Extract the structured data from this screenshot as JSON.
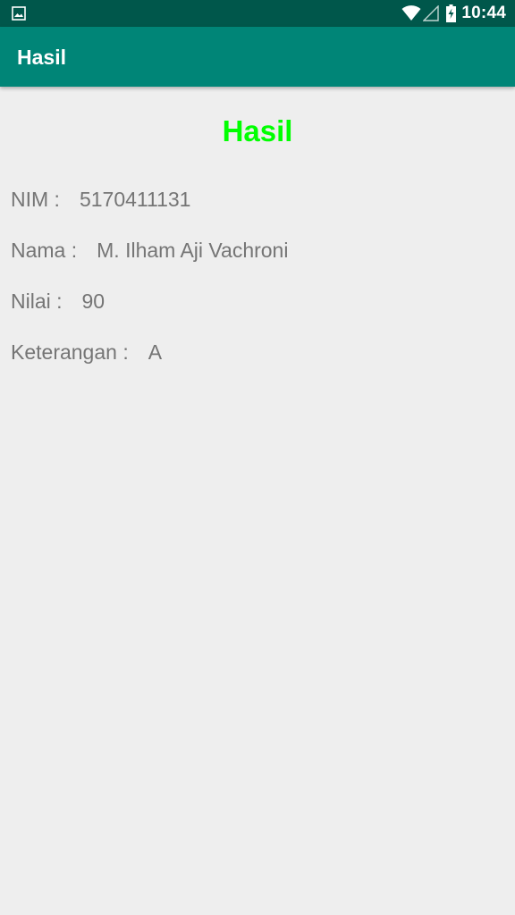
{
  "status_bar": {
    "time": "10:44",
    "icons": [
      "gallery-icon",
      "wifi-icon",
      "signal-icon",
      "battery-charging-icon"
    ]
  },
  "app_bar": {
    "title": "Hasil"
  },
  "result": {
    "heading": "Hasil",
    "heading_color": "#00ff00",
    "fields": [
      {
        "label": "NIM :",
        "value": "5170411131"
      },
      {
        "label": "Nama :",
        "value": "M. Ilham Aji Vachroni"
      },
      {
        "label": "Nilai :",
        "value": "90"
      },
      {
        "label": "Keterangan :",
        "value": "A"
      }
    ]
  },
  "colors": {
    "primary": "#008577",
    "primary_dark": "#00574b",
    "background": "#eeeeee",
    "text_secondary": "#757575"
  }
}
